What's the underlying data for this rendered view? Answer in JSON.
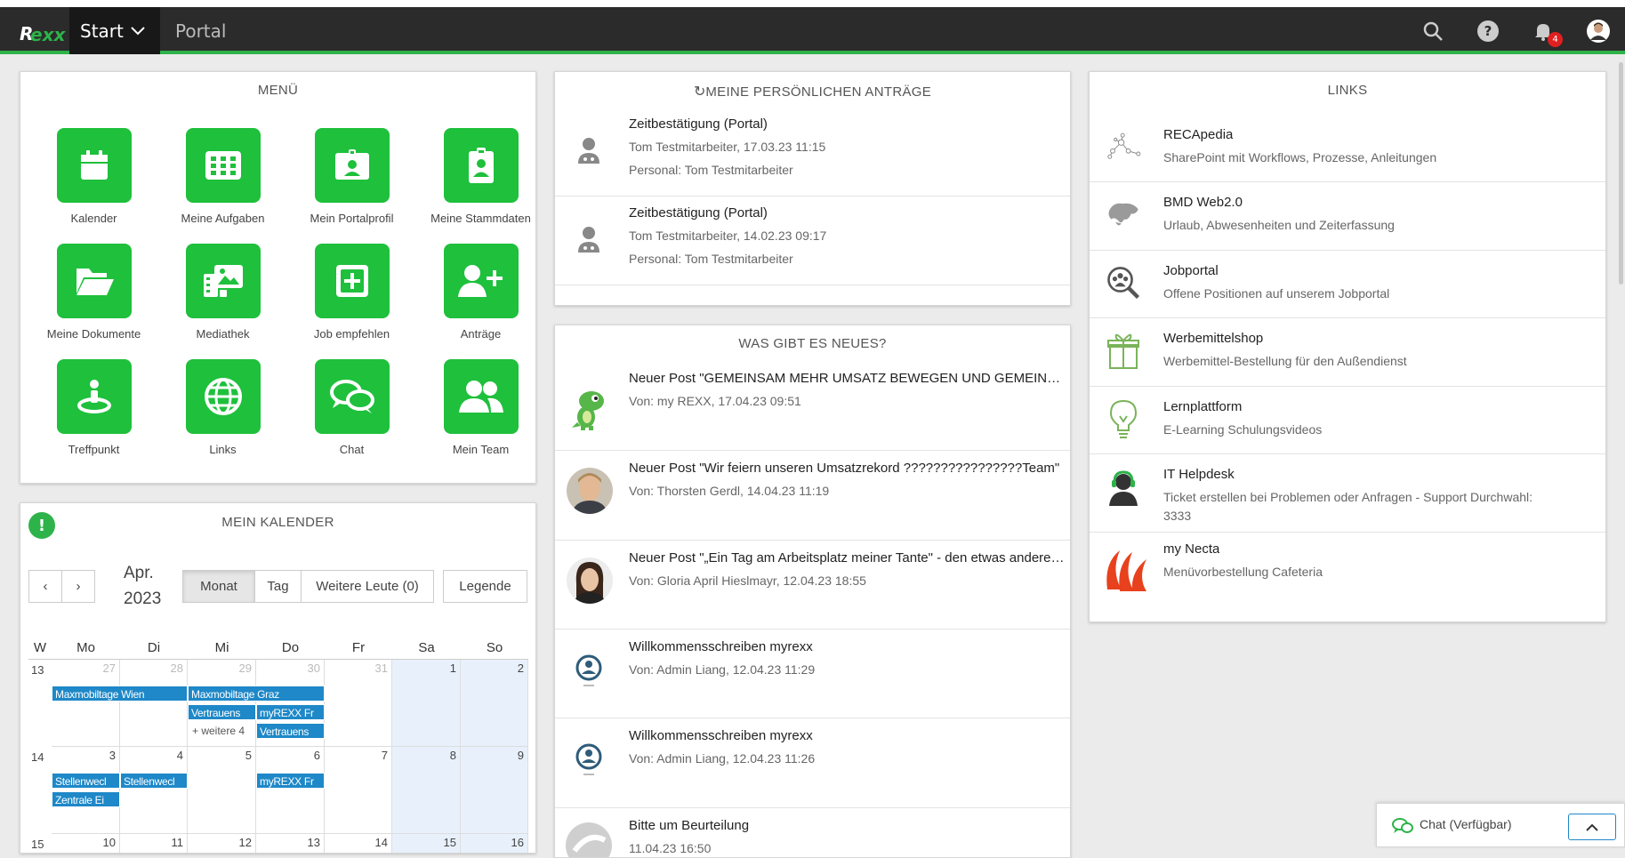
{
  "navbar": {
    "logo_r": "R",
    "logo_exx": "exx",
    "start_label": "Start",
    "portal_label": "Portal",
    "notification_count": "4"
  },
  "menu": {
    "title": "MENÜ",
    "tiles": [
      {
        "label": "Kalender",
        "icon": "calendar-icon"
      },
      {
        "label": "Meine Aufgaben",
        "icon": "grid-icon"
      },
      {
        "label": "Mein Portalprofil",
        "icon": "id-card-icon"
      },
      {
        "label": "Meine Stammdaten",
        "icon": "badge-icon"
      },
      {
        "label": "Meine Dokumente",
        "icon": "folder-open-icon"
      },
      {
        "label": "Mediathek",
        "icon": "media-icon"
      },
      {
        "label": "Job empfehlen",
        "icon": "plus-square-icon"
      },
      {
        "label": "Anträge",
        "icon": "user-plus-icon"
      },
      {
        "label": "Treffpunkt",
        "icon": "meeting-point-icon"
      },
      {
        "label": "Links",
        "icon": "globe-icon"
      },
      {
        "label": "Chat",
        "icon": "chat-icon"
      },
      {
        "label": "Mein Team",
        "icon": "team-icon"
      }
    ]
  },
  "calendar": {
    "title": "MEIN KALENDER",
    "month": "Apr.",
    "year": "2023",
    "buttons": {
      "prev": "‹",
      "next": "›",
      "month": "Monat",
      "day": "Tag",
      "more_people": "Weitere Leute (0)",
      "legend": "Legende"
    },
    "headers": [
      "W",
      "Mo",
      "Di",
      "Mi",
      "Do",
      "Fr",
      "Sa",
      "So"
    ],
    "weeks": [
      {
        "wk": "13",
        "days": [
          "27",
          "28",
          "29",
          "30",
          "31",
          "1",
          "2"
        ]
      },
      {
        "wk": "14",
        "days": [
          "3",
          "4",
          "5",
          "6",
          "7",
          "8",
          "9"
        ]
      },
      {
        "wk": "15",
        "days": [
          "10",
          "11",
          "12",
          "13",
          "14",
          "15",
          "16"
        ]
      }
    ],
    "events": {
      "e1": "Maxmobiltage Wien",
      "e2": "Maxmobiltage Graz",
      "e3": "Vertrauens",
      "e4": "myREXX Fr",
      "e5": "Vertrauens",
      "more": "+ weitere 4",
      "e6": "Stellenwecl",
      "e7": "Stellenwecl",
      "e8": "myREXX Fr",
      "e9": "Zentrale Ei"
    }
  },
  "requests": {
    "title": "MEINE PERSÖNLICHEN ANTRÄGE",
    "items": [
      {
        "title": "Zeitbestätigung (Portal)",
        "meta": "Tom Testmitarbeiter, 17.03.23 11:15",
        "person": "Personal: Tom Testmitarbeiter"
      },
      {
        "title": "Zeitbestätigung (Portal)",
        "meta": "Tom Testmitarbeiter, 14.02.23 09:17",
        "person": "Personal: Tom Testmitarbeiter"
      }
    ]
  },
  "news": {
    "title": "WAS GIBT ES NEUES?",
    "items": [
      {
        "title": "Neuer Post \"GEMEINSAM MEHR UMSATZ BEWEGEN UND GEMEINSAM MEHR ERREICHEN\"",
        "meta": "Von: my REXX, 17.04.23 09:51"
      },
      {
        "title": "Neuer Post \"Wir feiern unseren Umsatzrekord ????????????????Team\"",
        "meta": "Von: Thorsten Gerdl, 14.04.23 11:19"
      },
      {
        "title": "Neuer Post \"„Ein Tag am Arbeitsplatz meiner Tante\" - den etwas anderen Blick\"",
        "meta": "Von: Gloria April Hieslmayr, 12.04.23 18:55"
      },
      {
        "title": "Willkommensschreiben myrexx",
        "meta": "Von: Admin Liang, 12.04.23 11:29"
      },
      {
        "title": "Willkommensschreiben myrexx",
        "meta": "Von: Admin Liang, 12.04.23 11:26"
      },
      {
        "title": "Bitte um Beurteilung",
        "meta": "11.04.23 16:50"
      }
    ]
  },
  "links": {
    "title": "LINKS",
    "items": [
      {
        "title": "RECApedia",
        "desc": "SharePoint mit Workflows, Prozesse, Anleitungen",
        "icon": "network-icon"
      },
      {
        "title": "BMD Web2.0",
        "desc": "Urlaub, Abwesenheiten und Zeiterfassung",
        "icon": "world-map-icon"
      },
      {
        "title": "Jobportal",
        "desc": "Offene Positionen auf unserem Jobportal",
        "icon": "people-search-icon"
      },
      {
        "title": "Werbemittelshop",
        "desc": "Werbemittel-Bestellung für den Außendienst",
        "icon": "gift-icon"
      },
      {
        "title": "Lernplattform",
        "desc": "E-Learning Schulungsvideos",
        "icon": "lightbulb-icon"
      },
      {
        "title": "IT Helpdesk",
        "desc_1": "Ticket erstellen bei Problemen oder Anfragen - Support Durchwahl:",
        "desc_2": "3333",
        "icon": "headset-icon"
      },
      {
        "title": "my Necta",
        "desc": "Menüvorbestellung Cafeteria",
        "icon": "necta-logo-icon"
      }
    ]
  },
  "chat": {
    "label": "Chat (Verfügbar)"
  }
}
